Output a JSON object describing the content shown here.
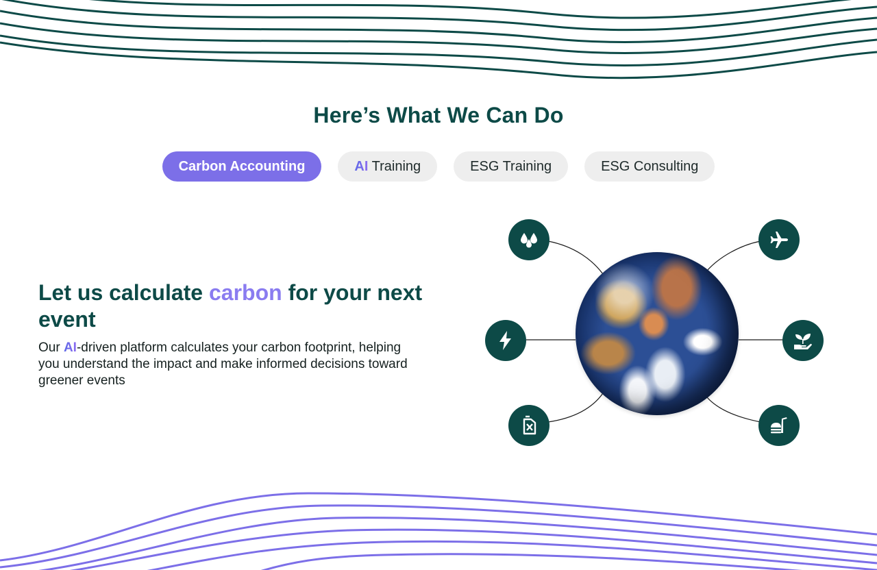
{
  "section": {
    "title": "Here’s What We Can Do"
  },
  "tabs": [
    {
      "label": "Carbon Accounting",
      "active": true
    },
    {
      "label_prefix": "AI",
      "label_suffix": " Training",
      "active": false
    },
    {
      "label": "ESG Training",
      "active": false
    },
    {
      "label": "ESG Consulting",
      "active": false
    }
  ],
  "hero": {
    "heading_pre": "Let us calculate ",
    "heading_accent": "carbon",
    "heading_post": " for your next event",
    "body_pre": "Our ",
    "body_accent": "AI",
    "body_post": "-driven platform calculates your carbon footprint, helping you understand the impact and make informed decisions toward greener events"
  },
  "diagram": {
    "nodes": [
      {
        "icon": "water-drops-icon"
      },
      {
        "icon": "airplane-icon"
      },
      {
        "icon": "lightning-bolt-icon"
      },
      {
        "icon": "plant-in-hand-icon"
      },
      {
        "icon": "fuel-canister-icon"
      },
      {
        "icon": "food-drink-icon"
      }
    ]
  },
  "colors": {
    "brand_dark": "#0d4a47",
    "accent_purple": "#7c6fe8",
    "tab_inactive": "#eeeeee",
    "wave_bottom": "#7c6fe8"
  }
}
